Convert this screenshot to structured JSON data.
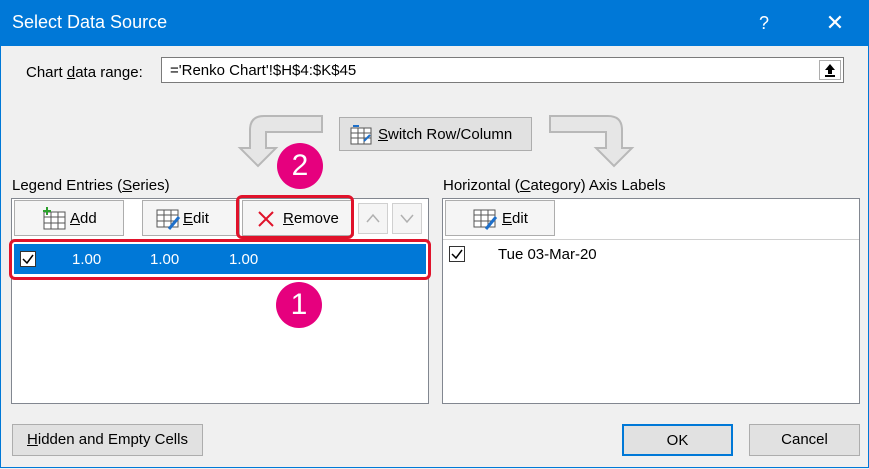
{
  "window": {
    "title": "Select Data Source",
    "help": "?",
    "close": "✕"
  },
  "range": {
    "label_pre": "Chart ",
    "label_u": "d",
    "label_post": "ata range:",
    "value": "='Renko Chart'!$H$4:$K$45"
  },
  "switch_button": {
    "pre": "",
    "u": "S",
    "post": "witch Row/Column"
  },
  "legend": {
    "label_pre": "Legend Entries (",
    "label_u": "S",
    "label_post": "eries)",
    "add": {
      "u": "A",
      "post": "dd"
    },
    "edit": {
      "pre": "",
      "u": "E",
      "post": "dit"
    },
    "remove": {
      "u": "R",
      "post": "emove"
    },
    "row": {
      "checked": true,
      "values": [
        "1.00",
        "1.00",
        "1.00"
      ]
    }
  },
  "axis": {
    "label_pre": "Horizontal (",
    "label_u": "C",
    "label_post": "ategory) Axis Labels",
    "edit": {
      "u": "E",
      "post": "dit"
    },
    "row": {
      "checked": true,
      "value": "Tue 03-Mar-20"
    }
  },
  "callouts": {
    "one": "1",
    "two": "2"
  },
  "footer": {
    "hidden_pre": "",
    "hidden_u": "H",
    "hidden_post": "idden and Empty Cells",
    "ok": "OK",
    "cancel": "Cancel"
  },
  "colors": {
    "accent": "#0078d7",
    "callout_border": "#e0132b",
    "badge": "#e6007e"
  }
}
